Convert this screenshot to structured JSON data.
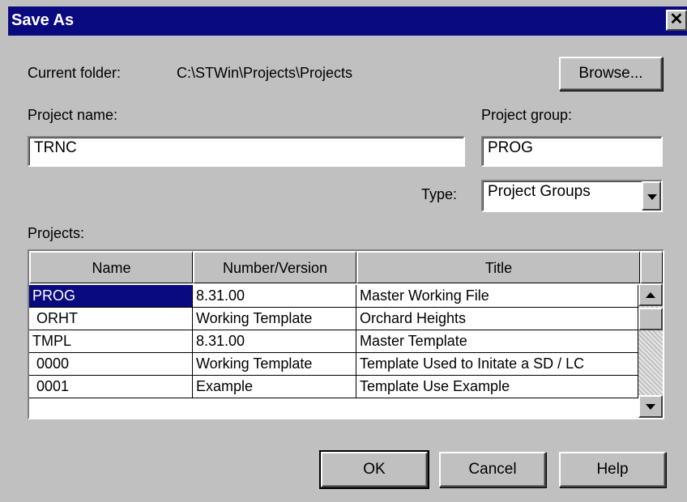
{
  "window": {
    "title": "Save As",
    "close_glyph": "✕"
  },
  "folder": {
    "label": "Current folder:",
    "path": "C:\\STWin\\Projects\\Projects",
    "browse": "Browse..."
  },
  "project_name": {
    "label": "Project name:",
    "value": "TRNC"
  },
  "project_group": {
    "label": "Project group:",
    "value": "PROG"
  },
  "type": {
    "label": "Type:",
    "value": "Project Groups"
  },
  "projects": {
    "label": "Projects:",
    "columns": [
      "Name",
      "Number/Version",
      "Title"
    ],
    "rows": [
      {
        "name": "PROG",
        "version": "8.31.00",
        "title": "Master Working File",
        "selected": true
      },
      {
        "name": " ORHT",
        "version": "Working Template",
        "title": "Orchard Heights"
      },
      {
        "name": "TMPL",
        "version": "8.31.00",
        "title": "Master Template"
      },
      {
        "name": " 0000",
        "version": "Working Template",
        "title": "Template Used to Initate a SD / LC"
      },
      {
        "name": " 0001",
        "version": "Example",
        "title": "Template Use Example"
      }
    ]
  },
  "buttons": {
    "ok": "OK",
    "cancel": "Cancel",
    "help": "Help"
  }
}
